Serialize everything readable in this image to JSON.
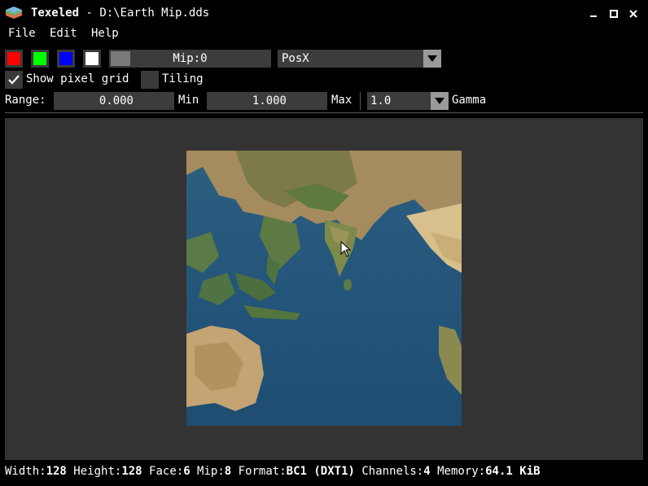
{
  "window": {
    "app_name": "Texeled",
    "separator": " - ",
    "file_path": "D:\\Earth Mip.dds"
  },
  "menu": [
    {
      "label": "File"
    },
    {
      "label": "Edit"
    },
    {
      "label": "Help"
    }
  ],
  "toolbar": {
    "channels": [
      {
        "name": "red",
        "color": "#ff0000"
      },
      {
        "name": "green",
        "color": "#00ff00"
      },
      {
        "name": "blue",
        "color": "#0000ff"
      },
      {
        "name": "alpha",
        "color": "#ffffff"
      }
    ],
    "mip_slider": {
      "label": "Mip:0",
      "value": 0
    },
    "face_select": {
      "value": "PosX"
    },
    "show_pixel_grid": {
      "label": "Show pixel grid",
      "checked": true
    },
    "tiling": {
      "label": "Tiling",
      "checked": false
    },
    "range": {
      "label": "Range:",
      "min_value": "0.000",
      "min_label": "Min",
      "max_value": "1.000",
      "max_label": "Max"
    },
    "gamma": {
      "value": "1.0",
      "label": "Gamma"
    }
  },
  "status": {
    "width_label": "Width:",
    "width": "128",
    "height_label": " Height:",
    "height": "128",
    "face_label": " Face:",
    "face": "6",
    "mip_label": " Mip:",
    "mip": "8",
    "format_label": " Format:",
    "format": "BC1 (DXT1)",
    "channels_label": " Channels:",
    "channels": "4",
    "memory_label": " Memory:",
    "memory": "64.1 KiB"
  },
  "colors": {
    "background": "#000000",
    "viewport": "#333333",
    "field": "#3c3c3c"
  }
}
